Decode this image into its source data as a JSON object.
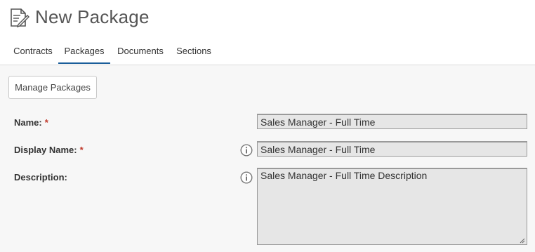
{
  "header": {
    "title": "New Package",
    "icon": "document-edit-icon"
  },
  "tabs": [
    {
      "label": "Contracts",
      "active": false
    },
    {
      "label": "Packages",
      "active": true
    },
    {
      "label": "Documents",
      "active": false
    },
    {
      "label": "Sections",
      "active": false
    }
  ],
  "toolbar": {
    "manage_packages_label": "Manage Packages"
  },
  "form": {
    "required_marker": "*",
    "name": {
      "label": "Name:",
      "required": true,
      "value": "Sales Manager - Full Time"
    },
    "display_name": {
      "label": "Display Name:",
      "required": true,
      "has_info": true,
      "value": "Sales Manager - Full Time"
    },
    "description": {
      "label": "Description:",
      "required": false,
      "has_info": true,
      "value": "Sales Manager - Full Time Description"
    }
  },
  "colors": {
    "accent": "#1a5e9a",
    "required": "#c0392b",
    "field_bg": "#e6e6e6",
    "panel_bg": "#f7f7f7"
  }
}
